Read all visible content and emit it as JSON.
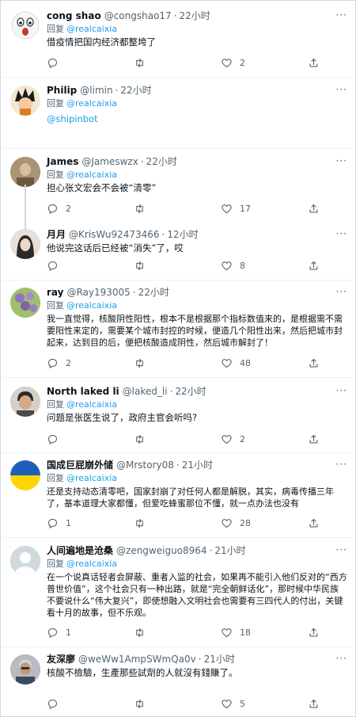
{
  "reply_prefix": "回复",
  "tweets": [
    {
      "name": "cong shao",
      "handle": "@congshao17",
      "time": "22小时",
      "reply_to": "@realcaixia",
      "text": "借疫情把国内经济都整垮了",
      "replies": "",
      "retweets": "",
      "likes": "2",
      "avatar_color": "#f6d34a"
    },
    {
      "name": "Philip",
      "handle": "@limin",
      "time": "22小时",
      "reply_to": "@realcaixia",
      "text": "@shipinbot",
      "replies": "",
      "retweets": "",
      "likes": "",
      "avatar_color": "#f3e7d3"
    },
    {
      "name": "James",
      "handle": "@Jameswzx",
      "time": "22小时",
      "reply_to": "@realcaixia",
      "text": "担心张文宏会不会被“清零”",
      "replies": "2",
      "retweets": "",
      "likes": "17",
      "avatar_color": "#8c7a5b"
    },
    {
      "name": "月月",
      "handle": "@KrisWu92473466",
      "time": "12小时",
      "reply_to": "@realcaixia",
      "text": "他说完这话后已经被“消失”了，哎",
      "replies": "",
      "retweets": "",
      "likes": "8",
      "avatar_color": "#d9cfc7"
    },
    {
      "name": "ray",
      "handle": "@Ray193005",
      "time": "22小时",
      "reply_to": "@realcaixia",
      "text": "我一直觉得，核酸阴性阳性，根本不是根据那个指标数值来的，是根据需不需要阳性来定的，需要某个城市封控的时候，便造几个阳性出来，然后把城市封起来，达到目的后，便把核酸造成阴性，然后城市解封了！",
      "replies": "2",
      "retweets": "",
      "likes": "48",
      "avatar_color": "#8f76b8"
    },
    {
      "name": "North laked li",
      "handle": "@laked_li",
      "time": "22小时",
      "reply_to": "@realcaixia",
      "text": "问题是张医生说了，政府主官会听吗?",
      "replies": "",
      "retweets": "",
      "likes": "2",
      "avatar_color": "#c9a98a"
    },
    {
      "name": "国成巨屁崩外储",
      "handle": "@Mrstory08",
      "time": "21小时",
      "reply_to": "@realcaixia",
      "text": "还是支持动态清零吧，国家封崩了对任何人都是解脱，其实，病毒传播三年了，基本道理大家都懂，但爱吃蜂蜜那位不懂，就一点办法也没有",
      "replies": "1",
      "retweets": "",
      "likes": "28",
      "avatar_color": "#ffd500"
    },
    {
      "name": "人间遍地是沧桑",
      "handle": "@zengweiguo8964",
      "time": "21小时",
      "reply_to": "@realcaixia",
      "text": "在一个说真话轻者会屏蔽、重者入监的社会，如果再不能引入他们反对的“西方普世价值”，这个社会只有一种出路，就是“完全朝鲜话化”，那时候中华民族不要说什么“伟大复兴”，即使想融入文明社会也需要有三四代人的付出，关键看十月的故事，但不乐观。",
      "replies": "1",
      "retweets": "",
      "likes": "18",
      "avatar_color": "#cfd9de"
    },
    {
      "name": "友深廖",
      "handle": "@weWw1AmpSWmQa0v",
      "time": "21小时",
      "reply_to": "@realcaixia",
      "text": "核酸不檢驗，生產那些試劑的人就沒有錢賺了。",
      "replies": "",
      "retweets": "",
      "likes": "5",
      "avatar_color": "#8a8f96"
    }
  ]
}
